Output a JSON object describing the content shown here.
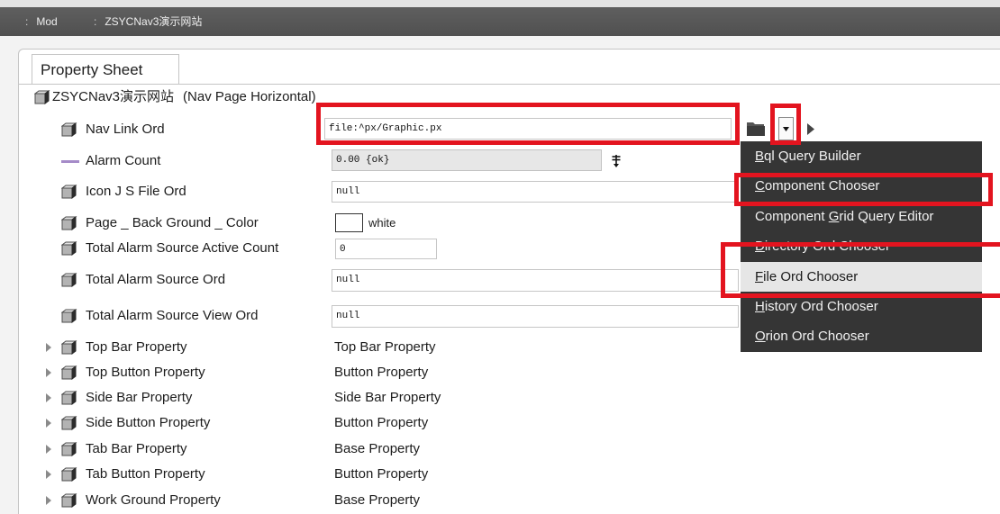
{
  "breadcrumb": [
    {
      "separator": ":",
      "label": "Mod"
    },
    {
      "separator": ":",
      "label": "ZSYCNav3演示网站"
    }
  ],
  "tabs": [
    {
      "label": "Property Sheet",
      "selected": true
    }
  ],
  "property_sheet": {
    "root": {
      "name": "ZSYCNav3演示网站",
      "type": "(Nav Page Horizontal)",
      "icon": "component-icon"
    },
    "properties": [
      {
        "label": "Nav Link Ord",
        "value": "file:^px/Graphic.px",
        "icon": "component-icon"
      },
      {
        "label": "Alarm Count",
        "value": "0.00 {ok}",
        "icon": "horizontal-line-icon"
      },
      {
        "label": "Icon J S File Ord",
        "value": "null",
        "icon": "component-icon"
      },
      {
        "label": "Page _ Back Ground _ Color",
        "value": "white",
        "swatch_color": "#ffffff",
        "icon": "component-icon"
      },
      {
        "label": "Total Alarm Source Active Count",
        "value": "0",
        "icon": "component-icon"
      },
      {
        "label": "Total Alarm Source Ord",
        "value": "null",
        "icon": "component-icon"
      },
      {
        "label": "Total Alarm Source View Ord",
        "value": "null",
        "icon": "component-icon"
      }
    ],
    "collapsed_properties": [
      {
        "label": "Top Bar Property",
        "type": "Top Bar Property"
      },
      {
        "label": "Top Button Property",
        "type": "Button Property"
      },
      {
        "label": "Side Bar Property",
        "type": "Side Bar Property"
      },
      {
        "label": "Side Button Property",
        "type": "Button Property"
      },
      {
        "label": "Tab Bar Property",
        "type": "Base Property"
      },
      {
        "label": "Tab Button Property",
        "type": "Button Property"
      },
      {
        "label": "Work Ground Property",
        "type": "Base Property"
      }
    ]
  },
  "ord_controls": {
    "browse_icon": "folder-icon",
    "chooser_icon": "chevron-down-icon",
    "go_icon": "play-icon",
    "alarm_flag_icon": "double-dagger-icon"
  },
  "ord_chooser_menu": {
    "items": [
      {
        "label": "Bql Query Builder",
        "mnemonic": "B"
      },
      {
        "label": "Component Chooser",
        "mnemonic": "C"
      },
      {
        "label": "Component Grid Query Editor",
        "mnemonic": "G"
      },
      {
        "label": "Directory Ord Chooser",
        "mnemonic": "D"
      },
      {
        "label": "File Ord Chooser",
        "mnemonic": "F",
        "highlighted": true
      },
      {
        "label": "History Ord Chooser",
        "mnemonic": "H"
      },
      {
        "label": "Orion Ord Chooser",
        "mnemonic": "O"
      }
    ]
  },
  "colors": {
    "annotation_red": "#e3141f",
    "menu_background": "#353535",
    "menu_highlight": "#e6e6e6",
    "alarm_count_icon": "#a58bc8",
    "top_bar": "#575757"
  }
}
